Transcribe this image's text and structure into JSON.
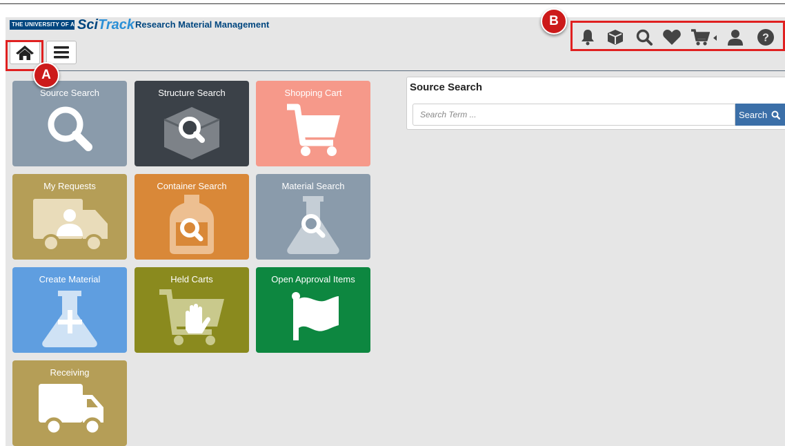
{
  "header": {
    "university": "THE UNIVERSITY OF AUCKLAND",
    "brand_part1": "Sci",
    "brand_part2": "Track",
    "tagline": "Research Material Management"
  },
  "nav": {
    "home_icon": "home-icon",
    "menu_icon": "hamburger-menu-icon"
  },
  "toolbar_icons": [
    "bell-icon",
    "box-icon",
    "search-icon",
    "heart-icon",
    "cart-icon",
    "user-icon",
    "help-icon"
  ],
  "tiles": [
    {
      "label": "Source Search",
      "color": "#8a9bab",
      "icon": "magnifier-icon"
    },
    {
      "label": "Structure Search",
      "color": "#3b4148",
      "icon": "structure-search-icon"
    },
    {
      "label": "Shopping Cart",
      "color": "#f6998a",
      "icon": "cart-icon"
    },
    {
      "label": "My Requests",
      "color": "#b59e57",
      "icon": "truck-user-icon"
    },
    {
      "label": "Container Search",
      "color": "#d98838",
      "icon": "container-search-icon"
    },
    {
      "label": "Material Search",
      "color": "#8a9bab",
      "icon": "flask-search-icon"
    },
    {
      "label": "Create Material",
      "color": "#5f9ee0",
      "icon": "flask-plus-icon"
    },
    {
      "label": "Held Carts",
      "color": "#8a8a1e",
      "icon": "cart-hand-icon"
    },
    {
      "label": "Open Approval Items",
      "color": "#0d8740",
      "icon": "flag-icon"
    },
    {
      "label": "Receiving",
      "color": "#b59e57",
      "icon": "truck-icon"
    }
  ],
  "search_panel": {
    "title": "Source Search",
    "placeholder": "Search Term ...",
    "button_label": "Search"
  },
  "annotations": {
    "a": "A",
    "b": "B"
  },
  "colors": {
    "brand_blue": "#00467f",
    "highlight_red": "#e02020"
  }
}
